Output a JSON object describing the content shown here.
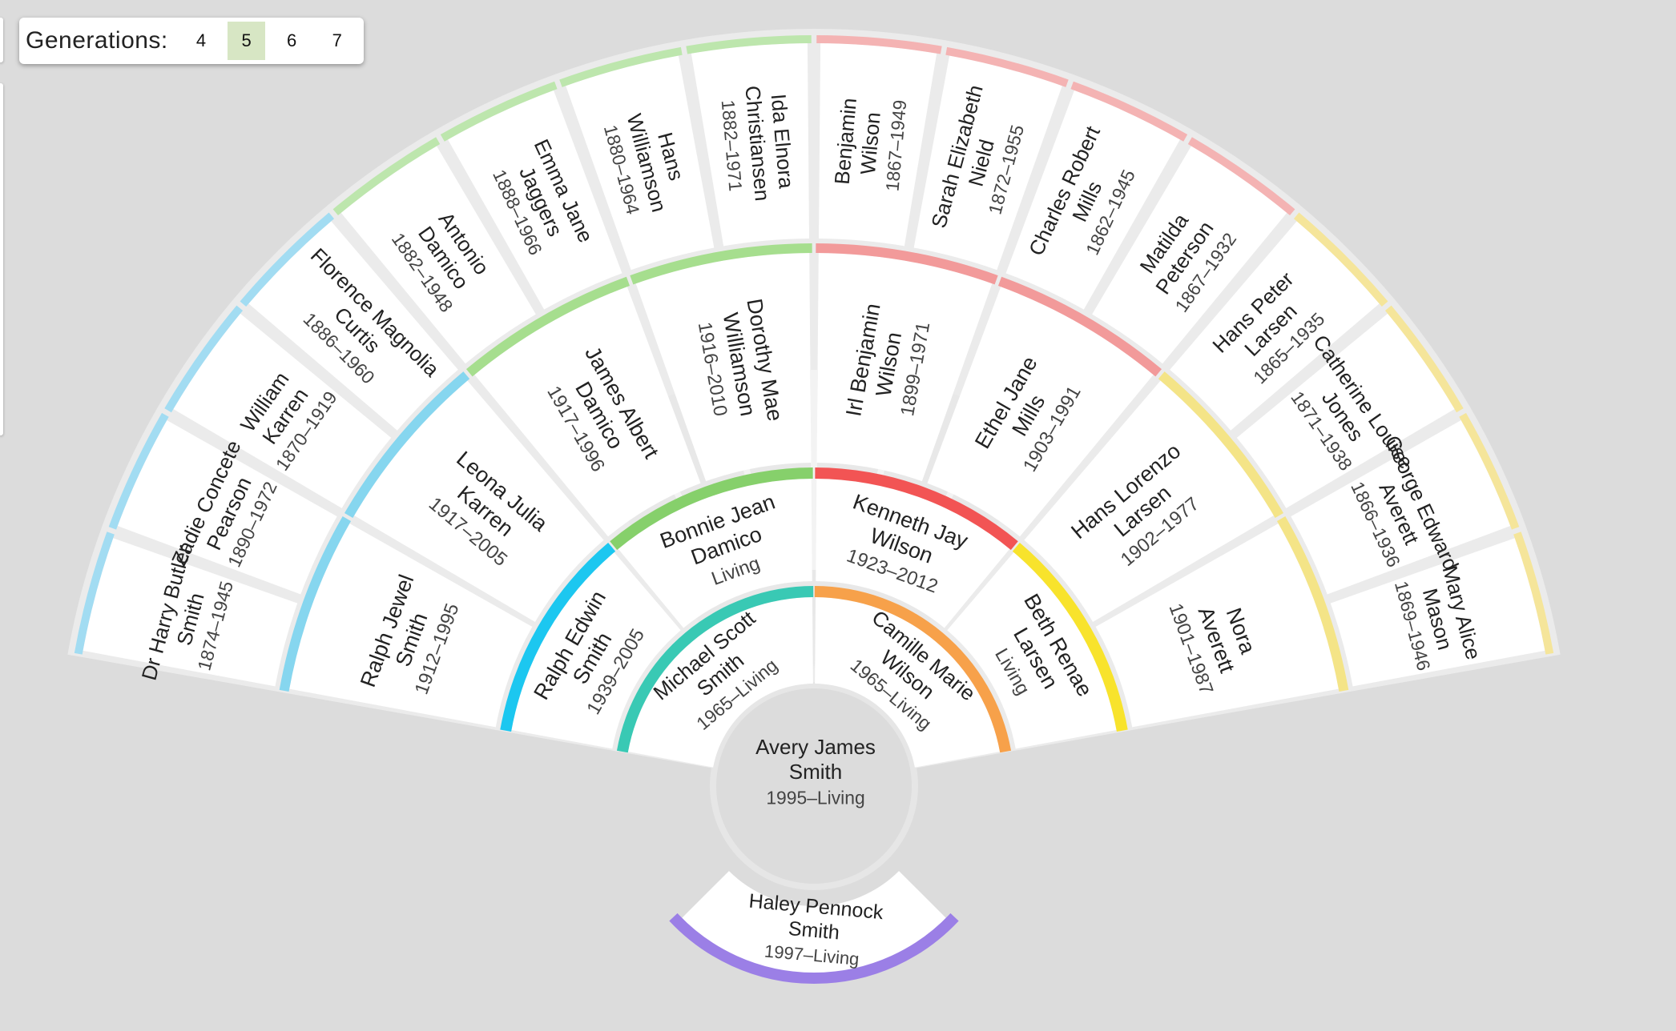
{
  "generations": {
    "label": "Generations:",
    "options": [
      "4",
      "5",
      "6",
      "7"
    ],
    "selected": "5"
  },
  "colors": {
    "background": "#dcdcdc",
    "ring_gap": "#ebebeb",
    "center": "#dcdcdc"
  },
  "root": {
    "name": [
      "Avery James",
      "Smith"
    ],
    "dates": "1995–Living"
  },
  "sibling": {
    "name": [
      "Haley Pennock",
      "Smith"
    ],
    "dates": "1997–Living",
    "color": "#9b7fe6"
  },
  "ring1": [
    {
      "name": [
        "Michael Scott",
        "Smith"
      ],
      "dates": "1965–Living",
      "color": "#39c9b4"
    },
    {
      "name": [
        "Camille Marie",
        "Wilson"
      ],
      "dates": "1965–Living",
      "color": "#f7a14a"
    }
  ],
  "ring2": [
    {
      "name": [
        "Ralph Edwin",
        "Smith"
      ],
      "dates": "1939–2005",
      "color": "#1cc7f0"
    },
    {
      "name": [
        "Bonnie Jean",
        "Damico"
      ],
      "dates": "Living",
      "color": "#86d06b"
    },
    {
      "name": [
        "Kenneth Jay",
        "Wilson"
      ],
      "dates": "1923–2012",
      "color": "#f25454"
    },
    {
      "name": [
        "Beth Renae",
        "Larsen"
      ],
      "dates": "Living",
      "color": "#f8e32c"
    }
  ],
  "ring3": [
    {
      "name": [
        "Ralph Jewel",
        "Smith"
      ],
      "dates": "1912–1995",
      "color": "#86d6ef"
    },
    {
      "name": [
        "Leona Julia",
        "Karren"
      ],
      "dates": "1917–2005",
      "color": "#86d6ef"
    },
    {
      "name": [
        "James Albert",
        "Damico"
      ],
      "dates": "1917–1996",
      "color": "#a6de8e"
    },
    {
      "name": [
        "Dorothy Mae",
        "Williamson"
      ],
      "dates": "1916–2010",
      "color": "#a6de8e"
    },
    {
      "name": [
        "Irl Benjamin",
        "Wilson"
      ],
      "dates": "1899–1971",
      "color": "#f29a9a"
    },
    {
      "name": [
        "Ethel Jane",
        "Mills"
      ],
      "dates": "1903–1991",
      "color": "#f29a9a"
    },
    {
      "name": [
        "Hans Lorenzo",
        "Larsen"
      ],
      "dates": "1902–1977",
      "color": "#f4e487"
    },
    {
      "name": [
        "Nora",
        "Averett"
      ],
      "dates": "1901–1987",
      "color": "#f4e487"
    }
  ],
  "ring4": [
    {
      "name": [
        "Dr Harry Butler",
        "Smith"
      ],
      "dates": "1874–1945",
      "color": "#a2dcf2"
    },
    {
      "name": [
        "Zadie Concete",
        "Pearson"
      ],
      "dates": "1890–1972",
      "color": "#a2dcf2"
    },
    {
      "name": [
        "William",
        "Karren"
      ],
      "dates": "1870–1919",
      "color": "#a2dcf2"
    },
    {
      "name": [
        "Florence Magnolia",
        "Curtis"
      ],
      "dates": "1886–1960",
      "color": "#a2dcf2"
    },
    {
      "name": [
        "Antonio",
        "Damico"
      ],
      "dates": "1882–1948",
      "color": "#bde6ad"
    },
    {
      "name": [
        "Emma Jane",
        "Jaggers"
      ],
      "dates": "1888–1966",
      "color": "#bde6ad"
    },
    {
      "name": [
        "Hans",
        "Williamson"
      ],
      "dates": "1880–1964",
      "color": "#bde6ad"
    },
    {
      "name": [
        "Ida Elnora",
        "Christiansen"
      ],
      "dates": "1882–1971",
      "color": "#bde6ad"
    },
    {
      "name": [
        "Benjamin",
        "Wilson"
      ],
      "dates": "1867–1949",
      "color": "#f4b3b3"
    },
    {
      "name": [
        "Sarah Elizabeth",
        "Nield"
      ],
      "dates": "1872–1955",
      "color": "#f4b3b3"
    },
    {
      "name": [
        "Charles Robert",
        "Mills"
      ],
      "dates": "1862–1945",
      "color": "#f4b3b3"
    },
    {
      "name": [
        "Matilda",
        "Peterson"
      ],
      "dates": "1867–1932",
      "color": "#f4b3b3"
    },
    {
      "name": [
        "Hans Peter",
        "Larsen"
      ],
      "dates": "1865–1935",
      "color": "#f5e59a"
    },
    {
      "name": [
        "Catherine Louise",
        "Jones"
      ],
      "dates": "1871–1938",
      "color": "#f5e59a"
    },
    {
      "name": [
        "George Edward",
        "Averett"
      ],
      "dates": "1866–1936",
      "color": "#f5e59a"
    },
    {
      "name": [
        "Mary Alice",
        "Mason"
      ],
      "dates": "1869–1946",
      "color": "#f5e59a"
    }
  ]
}
